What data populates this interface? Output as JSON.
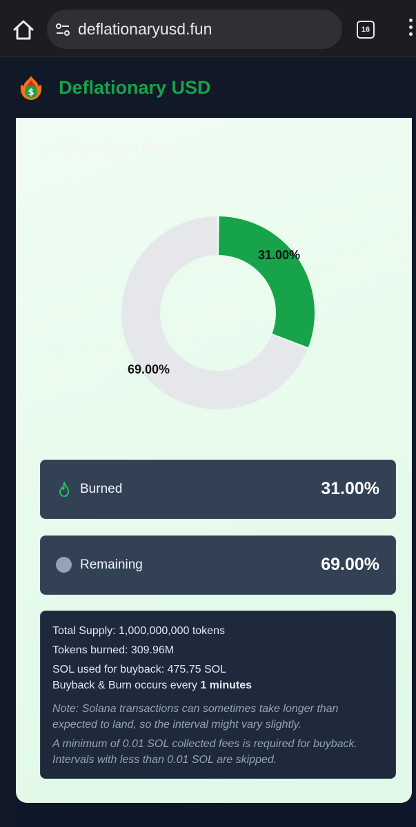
{
  "browser": {
    "url": "deflationaryusd.fun",
    "tab_count": "16"
  },
  "header": {
    "brand": "Deflationary USD"
  },
  "card": {
    "title": "Token Burn Progress",
    "chart_data": {
      "type": "pie",
      "categories": [
        "Burned",
        "Remaining"
      ],
      "values": [
        31.0,
        69.0
      ],
      "labels": [
        "31.00%",
        "69.00%"
      ],
      "colors": [
        "#16a34a",
        "#e5e7eb"
      ]
    }
  },
  "stats": {
    "burned_label": "Burned",
    "burned_value": "31.00%",
    "remaining_label": "Remaining",
    "remaining_value": "69.00%"
  },
  "info": {
    "total_supply": "Total Supply: 1,000,000,000 tokens",
    "tokens_burned": "Tokens burned: 309.96M",
    "sol_used": "SOL used for buyback: 475.75 SOL",
    "interval_prefix": "Buyback & Burn occurs every ",
    "interval_value": "1 minutes",
    "note1": "Note: Solana transactions can sometimes take longer than expected to land, so the interval might vary slightly.",
    "note2": "A minimum of 0.01 SOL collected fees is required for buyback. Intervals with less than 0.01 SOL are skipped."
  }
}
